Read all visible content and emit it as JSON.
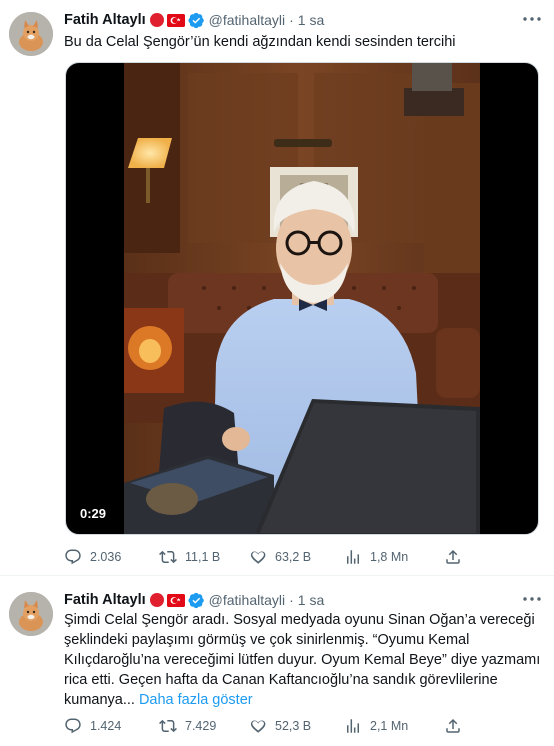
{
  "tweets": [
    {
      "author": {
        "name": "Fatih Altaylı",
        "handle": "@fatihaltayli"
      },
      "separator": "·",
      "time": "1 sa",
      "text": "Bu da Celal Şengör’ün kendi ağzından kendi sesinden tercihi",
      "video": {
        "duration": "0:29"
      },
      "stats": {
        "replies": "2.036",
        "retweets": "11,1 B",
        "likes": "63,2 B",
        "views": "1,8 Mn"
      }
    },
    {
      "author": {
        "name": "Fatih Altaylı",
        "handle": "@fatihaltayli"
      },
      "separator": "·",
      "time": "1 sa",
      "text": "Şimdi Celal Şengör aradı. Sosyal medyada oyunu Sinan Oğan’a vereceği\nşeklindeki paylaşımı görmüş ve çok sinirlenmiş. “Oyumu Kemal\nKılıçdaroğlu’na vereceğimi lütfen duyur. Oyum Kemal Beye” diye yazmamı\nrica etti. Geçen hafta da Canan Kaftancıoğlu’na sandık görevlilerine\nkumanya... ",
      "show_more": "Daha fazla göster",
      "stats": {
        "replies": "1.424",
        "retweets": "7.429",
        "likes": "52,3 B",
        "views": "2,1 Mn"
      }
    }
  ],
  "icons": {
    "more": "more-horizontal-icon",
    "reply": "reply-icon",
    "retweet": "retweet-icon",
    "like": "heart-icon",
    "views": "views-chart-icon",
    "share": "share-icon",
    "verified": "verified-badge-icon",
    "flag": "turkish-flag-icon"
  },
  "colors": {
    "accent": "#1d9bf0",
    "secondary_text": "#536471",
    "flag_red": "#e30a17"
  }
}
